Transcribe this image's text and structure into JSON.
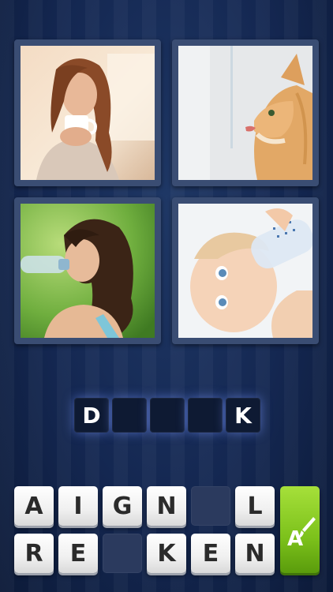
{
  "puzzle": {
    "images": [
      {
        "id": "tile-1",
        "subject": "woman sipping from mug"
      },
      {
        "id": "tile-2",
        "subject": "cat drinking from tap"
      },
      {
        "id": "tile-3",
        "subject": "woman drinking bottled water"
      },
      {
        "id": "tile-4",
        "subject": "baby with bottle"
      }
    ],
    "answer_slots": [
      "D",
      "",
      "",
      "",
      "K"
    ]
  },
  "letter_keys": {
    "row1": [
      "A",
      "I",
      "G",
      "N",
      "",
      "L"
    ],
    "row2": [
      "R",
      "E",
      "",
      "K",
      "E",
      "N"
    ]
  },
  "hint": {
    "label": "A",
    "icon": "brush-icon"
  },
  "colors": {
    "background": "#142751",
    "slot": "#0e1a33",
    "key": "#f5f5f5",
    "hint": "#7cc11b"
  }
}
